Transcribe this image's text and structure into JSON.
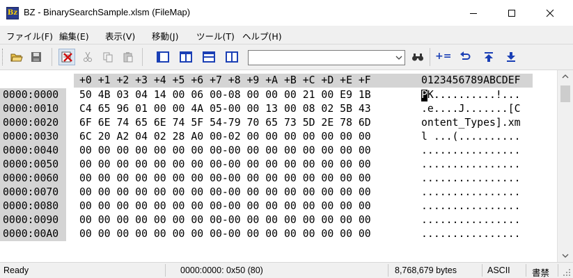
{
  "window": {
    "icon_label": "Bz",
    "title": "BZ - BinarySearchSample.xlsm (FileMap)"
  },
  "menu": [
    "ファイル(F)",
    "編集(E)",
    "表示(V)",
    "移動(J)",
    "ツール(T)",
    "ヘルプ(H)"
  ],
  "toolbar": {
    "icons": [
      "open-icon",
      "save-icon",
      "readonly-icon",
      "cut-icon",
      "copy-icon",
      "paste-icon",
      "view-single-icon",
      "view-split-vertical-icon",
      "view-split-horizontal-icon",
      "view-compare-icon",
      "find-icon",
      "add-icon",
      "back-icon",
      "jump-top-icon",
      "jump-bottom-icon"
    ],
    "search_value": "",
    "add_label": "+="
  },
  "hex": {
    "header_cols": "+0 +1 +2 +3 +4 +5 +6 +7 +8 +9 +A +B +C +D +E +F",
    "header_ascii": "0123456789ABCDEF",
    "rows": [
      {
        "addr": "0000:0000",
        "hex": "50 4B 03 04 14 00 06 00-08 00 00 00 21 00 E9 1B",
        "ascii": "PK..........!..."
      },
      {
        "addr": "0000:0010",
        "hex": "C4 65 96 01 00 00 4A 05-00 00 13 00 08 02 5B 43",
        "ascii": ".e....J.......[C"
      },
      {
        "addr": "0000:0020",
        "hex": "6F 6E 74 65 6E 74 5F 54-79 70 65 73 5D 2E 78 6D",
        "ascii": "ontent_Types].xm"
      },
      {
        "addr": "0000:0030",
        "hex": "6C 20 A2 04 02 28 A0 00-02 00 00 00 00 00 00 00",
        "ascii": "l ...(.........."
      },
      {
        "addr": "0000:0040",
        "hex": "00 00 00 00 00 00 00 00-00 00 00 00 00 00 00 00",
        "ascii": "................"
      },
      {
        "addr": "0000:0050",
        "hex": "00 00 00 00 00 00 00 00-00 00 00 00 00 00 00 00",
        "ascii": "................"
      },
      {
        "addr": "0000:0060",
        "hex": "00 00 00 00 00 00 00 00-00 00 00 00 00 00 00 00",
        "ascii": "................"
      },
      {
        "addr": "0000:0070",
        "hex": "00 00 00 00 00 00 00 00-00 00 00 00 00 00 00 00",
        "ascii": "................"
      },
      {
        "addr": "0000:0080",
        "hex": "00 00 00 00 00 00 00 00-00 00 00 00 00 00 00 00",
        "ascii": "................"
      },
      {
        "addr": "0000:0090",
        "hex": "00 00 00 00 00 00 00 00-00 00 00 00 00 00 00 00",
        "ascii": "................"
      },
      {
        "addr": "0000:00A0",
        "hex": "00 00 00 00 00 00 00 00-00 00 00 00 00 00 00 00",
        "ascii": "................"
      }
    ]
  },
  "status": {
    "state": "Ready",
    "position": "0000:0000: 0x50 (80)",
    "size": "8,768,679 bytes",
    "encoding": "ASCII",
    "mode": "書禁"
  },
  "colors": {
    "gutter": "#d4d4d4",
    "toolbar_accent": "#1a3fb5"
  }
}
